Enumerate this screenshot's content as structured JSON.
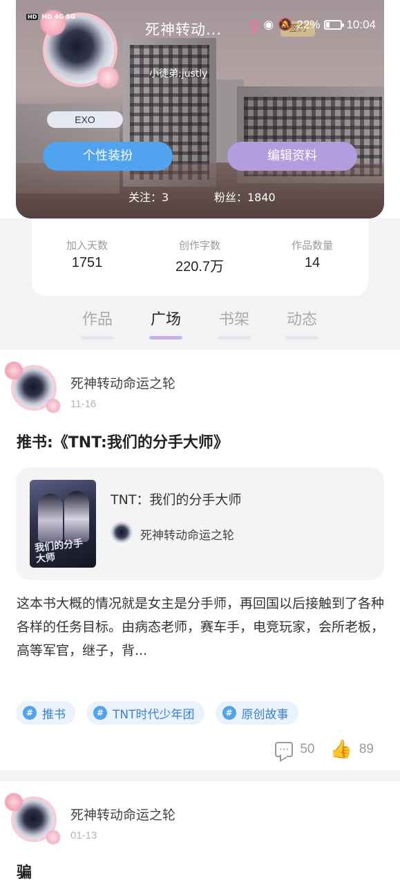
{
  "status_bar": {
    "left_text": "HD 4G 5G",
    "battery": "22%",
    "time": "10:04"
  },
  "profile": {
    "nickname": "死神转动...",
    "gender_symbol": "♀",
    "sign_badge": "签约",
    "subtitle": "小徒弟:justly",
    "tag": "EXO",
    "dress_button": "个性装扮",
    "edit_button": "编辑资料",
    "following": "关注：3",
    "followers": "粉丝：1840"
  },
  "stats": [
    {
      "label": "加入天数",
      "value": "1751"
    },
    {
      "label": "创作字数",
      "value": "220.7万"
    },
    {
      "label": "作品数量",
      "value": "14"
    }
  ],
  "tabs": [
    {
      "label": "作品"
    },
    {
      "label": "广场"
    },
    {
      "label": "书架"
    },
    {
      "label": "动态"
    }
  ],
  "active_tab": "广场",
  "posts": [
    {
      "author": "死神转动命运之轮",
      "date": "11-16",
      "title": "推书:《TNT:我们的分手大师》",
      "book": {
        "title": "TNT：我们的分手大师",
        "author": "死神转动命运之轮",
        "cover_text": "我们的分手大师"
      },
      "body": "这本书大概的情况就是女主是分手师，再回国以后接触到了各种各样的任务目标。由病态老师，赛车手，电竞玩家，会所老板，高等军官，继子，背...",
      "topics": [
        "推书",
        "TNT时代少年团",
        "原创故事"
      ],
      "comments": "50",
      "likes": "89"
    },
    {
      "author": "死神转动命运之轮",
      "date": "01-13",
      "title": "骗"
    }
  ],
  "colors": {
    "accent_blue": "#4fa3ef",
    "accent_purple": "#b49ddf",
    "tab_indicator": "#c7b2e8"
  }
}
